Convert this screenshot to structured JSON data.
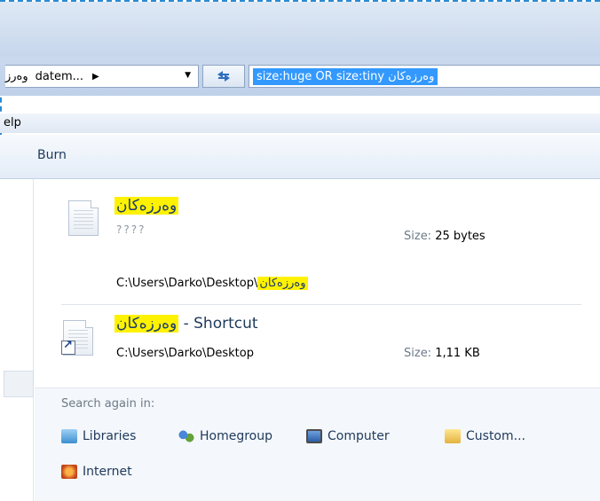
{
  "address": {
    "prefix_rtl": "وەرز",
    "crumb": "datem...",
    "separator": "▶",
    "dropdown": "▼"
  },
  "search": {
    "query": "وەرزەکان size:huge OR size:tiny"
  },
  "menubar": {
    "help_partial": "elp"
  },
  "toolbar": {
    "burn_label": "Burn"
  },
  "results": [
    {
      "name": "وەرزەکان",
      "subtitle": "????",
      "size_label": "Size:",
      "size_value": "25 bytes",
      "path_prefix": "C:\\Users\\Darko\\Desktop\\",
      "path_highlight": "وەرزەکان"
    },
    {
      "name_highlight": "وەرزەکان",
      "name_suffix": " - Shortcut",
      "path": "C:\\Users\\Darko\\Desktop",
      "size_label": "Size:",
      "size_value": "1,11 KB"
    }
  ],
  "search_again": {
    "title": "Search again in:",
    "locations": [
      {
        "label": "Libraries",
        "icon": "libraries-icon"
      },
      {
        "label": "Homegroup",
        "icon": "homegroup-icon"
      },
      {
        "label": "Computer",
        "icon": "computer-icon"
      },
      {
        "label": "Custom...",
        "icon": "custom-icon"
      },
      {
        "label": "Internet",
        "icon": "internet-icon"
      }
    ]
  },
  "colors": {
    "highlight": "#fff200",
    "selection": "#3399ff",
    "link_text": "#1e395b"
  }
}
